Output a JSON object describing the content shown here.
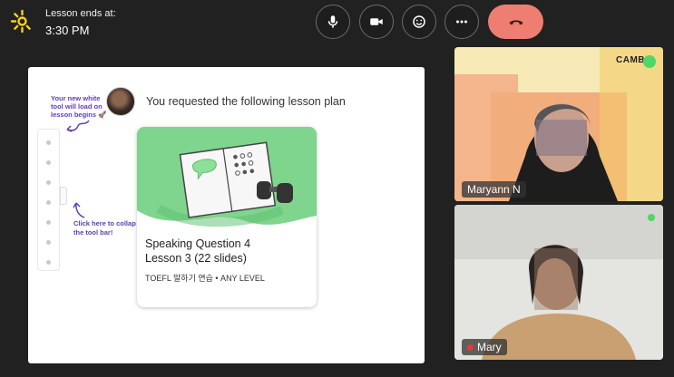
{
  "header": {
    "logo_icon": "sun-logo-icon",
    "lesson_label": "Lesson ends at:",
    "lesson_time": "3:30 PM"
  },
  "controls": {
    "mic_icon": "microphone-icon",
    "camera_icon": "video-camera-icon",
    "emoji_icon": "smiley-icon",
    "more_icon": "more-dots-icon",
    "end_icon": "hang-up-icon",
    "end_color": "#ef7e72"
  },
  "whiteboard": {
    "hint_top": [
      "Your new white",
      "tool will load on",
      "lesson begins 🚀"
    ],
    "title": "You requested the following lesson plan",
    "hint_bottom": [
      "Click here to collap",
      "the tool bar!"
    ],
    "lesson_card": {
      "title_line1": "Speaking Question 4",
      "title_line2": "Lesson 3 (22 slides)",
      "meta": "TOEFL 말하기 연습 • ANY LEVEL",
      "accent": "#7fd58d"
    }
  },
  "participants": [
    {
      "name": "Maryann N",
      "brand_text": "CAMB",
      "online": true
    },
    {
      "name": "Mary",
      "mic_muted": true,
      "online": true
    }
  ]
}
